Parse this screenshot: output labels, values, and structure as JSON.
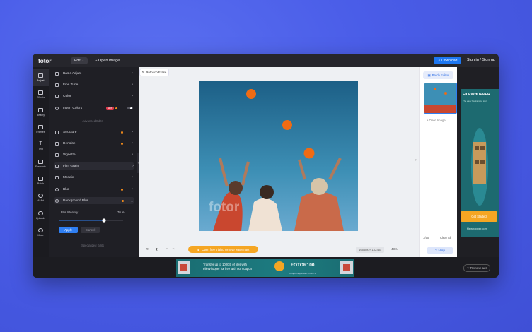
{
  "topbar": {
    "logo": "fotor",
    "edit_label": "Edit ⌄",
    "open_image": "+ Open Image",
    "download": "⇩ Download",
    "signin": "Sign in / Sign up"
  },
  "rail": [
    {
      "label": "Adjust",
      "active": true
    },
    {
      "label": "Effects"
    },
    {
      "label": "Beauty"
    },
    {
      "label": "Frames"
    },
    {
      "label": "Text"
    },
    {
      "label": "Elements"
    },
    {
      "label": "Batch"
    },
    {
      "label": "AI Art"
    },
    {
      "label": "Uploads"
    },
    {
      "label": "More"
    }
  ],
  "panel": {
    "items": [
      {
        "label": "Basic Adjust"
      },
      {
        "label": "Fine Tune"
      },
      {
        "label": "Color"
      },
      {
        "label": "Invert Colors",
        "badge": "NEW"
      }
    ],
    "advanced_label": "Advanced Edits",
    "advanced": [
      {
        "label": "Structure"
      },
      {
        "label": "Denoise"
      },
      {
        "label": "Vignette"
      },
      {
        "label": "Film Grain"
      },
      {
        "label": "Mosaic"
      },
      {
        "label": "Blur"
      },
      {
        "label": "Background Blur"
      }
    ],
    "blur_intensity_label": "Blur Intensity",
    "blur_intensity_value": "70 %",
    "blur_intensity": 0.7,
    "apply": "Apply",
    "cancel": "Cancel",
    "specialized_label": "Specialized Edits"
  },
  "canvas": {
    "retouch_tab": "Retouch/Erase",
    "warn_text": "Open free trial to remove watermark",
    "dims": "1665px × 1024px",
    "zoom": "43%",
    "watermark": "fotor"
  },
  "thumbs": {
    "batch_editor": "Batch Editor",
    "open_image": "+ Open Image",
    "count": "1/50",
    "clear_all": "Clear All",
    "help": "Help"
  },
  "ad": {
    "title": "FILEWHOPPER",
    "subtitle": "The easy file transfer tool",
    "cta": "Get Started",
    "url": "filewhopper.com"
  },
  "banner": {
    "line1": "Transfer up to 100GB of files with",
    "line2": "FileWhopper for free with our coupon",
    "code": "FOTOR100",
    "code_sub": "Coupon applicable till Feb 1"
  },
  "remove_ads": "Remove ads"
}
